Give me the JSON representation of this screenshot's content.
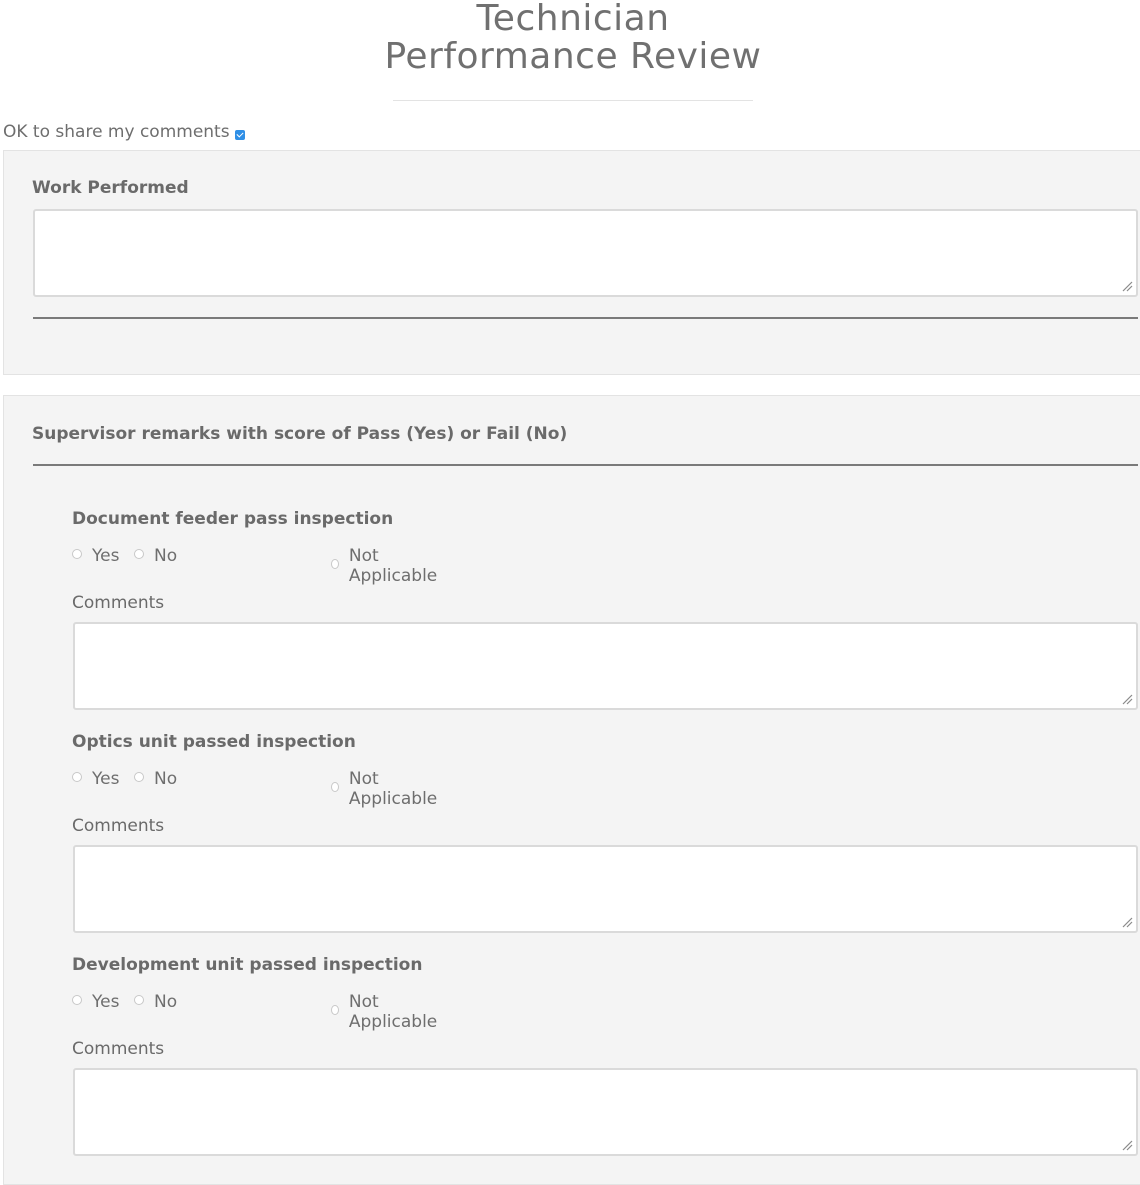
{
  "header": {
    "title_cut": "y",
    "title_line1": "Technician",
    "title_line2": "Performance Review"
  },
  "share": {
    "label": "OK to share my comments",
    "checked": true
  },
  "work_section": {
    "label": "Work Performed",
    "value": ""
  },
  "supervisor_section": {
    "heading": "Supervisor remarks with score of Pass (Yes) or Fail (No)",
    "questions": [
      {
        "label": "Document feeder pass inspection",
        "options": [
          "Yes",
          "No",
          "Not Applicable"
        ],
        "comments_label": "Comments",
        "comments_value": ""
      },
      {
        "label": "Optics unit passed inspection",
        "options": [
          "Yes",
          "No",
          "Not Applicable"
        ],
        "comments_label": "Comments",
        "comments_value": ""
      },
      {
        "label": "Development unit passed inspection",
        "options": [
          "Yes",
          "No",
          "Not Applicable"
        ],
        "comments_label": "Comments",
        "comments_value": ""
      }
    ]
  },
  "colors": {
    "checkbox": "#2f8fe6",
    "panel_bg": "#f4f4f4",
    "text": "#6f6f6f"
  }
}
